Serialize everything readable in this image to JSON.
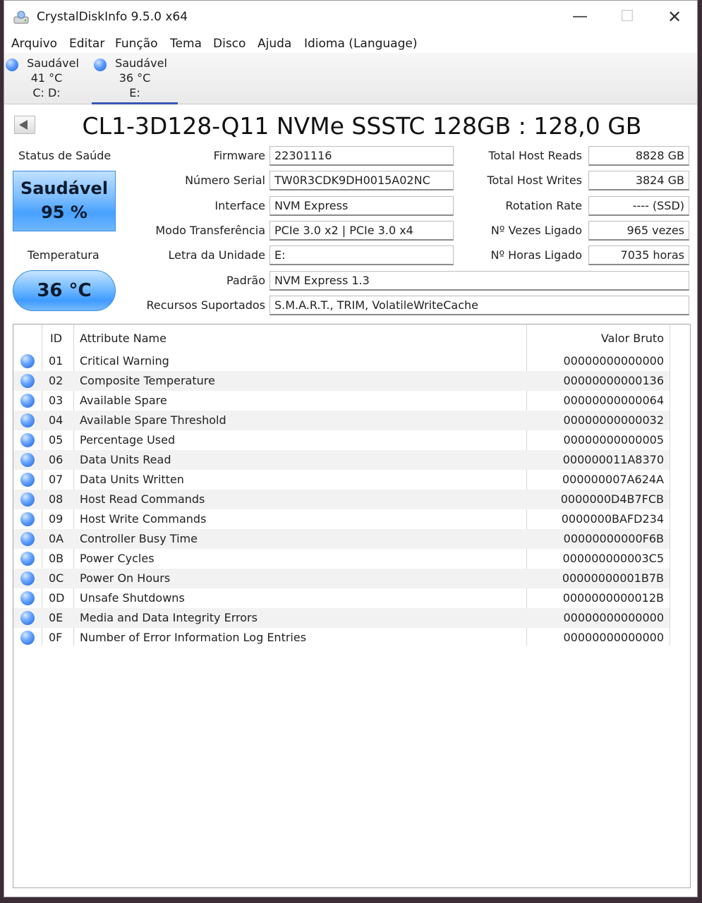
{
  "window": {
    "title": "CrystalDiskInfo 9.5.0 x64",
    "controls": {
      "minimize": "—",
      "maximize": "☐",
      "close": "✕"
    }
  },
  "menu": [
    "Arquivo",
    "Editar",
    "Função",
    "Tema",
    "Disco",
    "Ajuda",
    "Idioma (Language)"
  ],
  "drive_tabs": [
    {
      "status": "Saudável",
      "temp": "41 °C",
      "letters": "C: D:"
    },
    {
      "status": "Saudável",
      "temp": "36 °C",
      "letters": "E:"
    }
  ],
  "drive": {
    "title": "CL1-3D128-Q11 NVMe SSSTC 128GB : 128,0 GB",
    "health_label": "Status de Saúde",
    "health_status": "Saudável",
    "health_percent": "95 %",
    "temp_label": "Temperatura",
    "temp_value": "36 °C",
    "health_color": "#4aa3ff"
  },
  "fields": {
    "firmware": {
      "label": "Firmware",
      "value": "22301116"
    },
    "serial": {
      "label": "Número Serial",
      "value": "TW0R3CDK9DH0015A02NC"
    },
    "interface": {
      "label": "Interface",
      "value": "NVM Express"
    },
    "transfer": {
      "label": "Modo Transferência",
      "value": "PCIe 3.0 x2 | PCIe 3.0 x4"
    },
    "letter": {
      "label": "Letra da Unidade",
      "value": "E:"
    },
    "standard": {
      "label": "Padrão",
      "value": "NVM Express 1.3"
    },
    "features": {
      "label": "Recursos Suportados",
      "value": "S.M.A.R.T., TRIM, VolatileWriteCache"
    },
    "host_reads": {
      "label": "Total Host Reads",
      "value": "8828 GB"
    },
    "host_writes": {
      "label": "Total Host Writes",
      "value": "3824 GB"
    },
    "rotation": {
      "label": "Rotation Rate",
      "value": "---- (SSD)"
    },
    "power_count": {
      "label": "Nº Vezes Ligado",
      "value": "965 vezes"
    },
    "power_hours": {
      "label": "Nº Horas Ligado",
      "value": "7035 horas"
    }
  },
  "smart": {
    "headers": {
      "id": "ID",
      "name": "Attribute Name",
      "raw": "Valor Bruto"
    },
    "rows": [
      {
        "id": "01",
        "name": "Critical Warning",
        "raw": "00000000000000"
      },
      {
        "id": "02",
        "name": "Composite Temperature",
        "raw": "00000000000136"
      },
      {
        "id": "03",
        "name": "Available Spare",
        "raw": "00000000000064"
      },
      {
        "id": "04",
        "name": "Available Spare Threshold",
        "raw": "00000000000032"
      },
      {
        "id": "05",
        "name": "Percentage Used",
        "raw": "00000000000005"
      },
      {
        "id": "06",
        "name": "Data Units Read",
        "raw": "000000011A8370"
      },
      {
        "id": "07",
        "name": "Data Units Written",
        "raw": "000000007A624A"
      },
      {
        "id": "08",
        "name": "Host Read Commands",
        "raw": "0000000D4B7FCB"
      },
      {
        "id": "09",
        "name": "Host Write Commands",
        "raw": "0000000BAFD234"
      },
      {
        "id": "0A",
        "name": "Controller Busy Time",
        "raw": "00000000000F6B"
      },
      {
        "id": "0B",
        "name": "Power Cycles",
        "raw": "000000000003C5"
      },
      {
        "id": "0C",
        "name": "Power On Hours",
        "raw": "00000000001B7B"
      },
      {
        "id": "0D",
        "name": "Unsafe Shutdowns",
        "raw": "0000000000012B"
      },
      {
        "id": "0E",
        "name": "Media and Data Integrity Errors",
        "raw": "00000000000000"
      },
      {
        "id": "0F",
        "name": "Number of Error Information Log Entries",
        "raw": "00000000000000"
      }
    ]
  }
}
